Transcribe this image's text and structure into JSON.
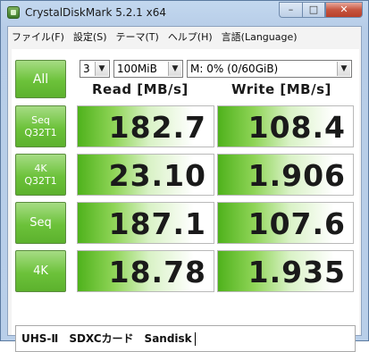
{
  "window": {
    "title": "CrystalDiskMark 5.2.1 x64",
    "caption_min": "–",
    "caption_max": "□",
    "caption_close": "✕"
  },
  "menu": {
    "items": [
      "ファイル(F)",
      "設定(S)",
      "テーマ(T)",
      "ヘルプ(H)",
      "言語(Language)"
    ]
  },
  "controls": {
    "all_label": "All",
    "count_value": "3",
    "size_value": "100MiB",
    "drive_value": "M: 0% (0/60GiB)"
  },
  "headers": {
    "read": "Read [MB/s]",
    "write": "Write [MB/s]"
  },
  "tests": [
    {
      "label_line1": "Seq",
      "label_line2": "Q32T1",
      "read": "182.7",
      "write": "108.4"
    },
    {
      "label_line1": "4K",
      "label_line2": "Q32T1",
      "read": "23.10",
      "write": "1.906"
    },
    {
      "label_line1": "Seq",
      "label_line2": "",
      "read": "187.1",
      "write": "107.6"
    },
    {
      "label_line1": "4K",
      "label_line2": "",
      "read": "18.78",
      "write": "1.935"
    }
  ],
  "comment": "UHS-Ⅱ　SDXCカード　Sandisk",
  "colors": {
    "accent_green": "#6cc23a",
    "bar_green": "#4fb21c",
    "window_frame": "#b9cfe9"
  }
}
